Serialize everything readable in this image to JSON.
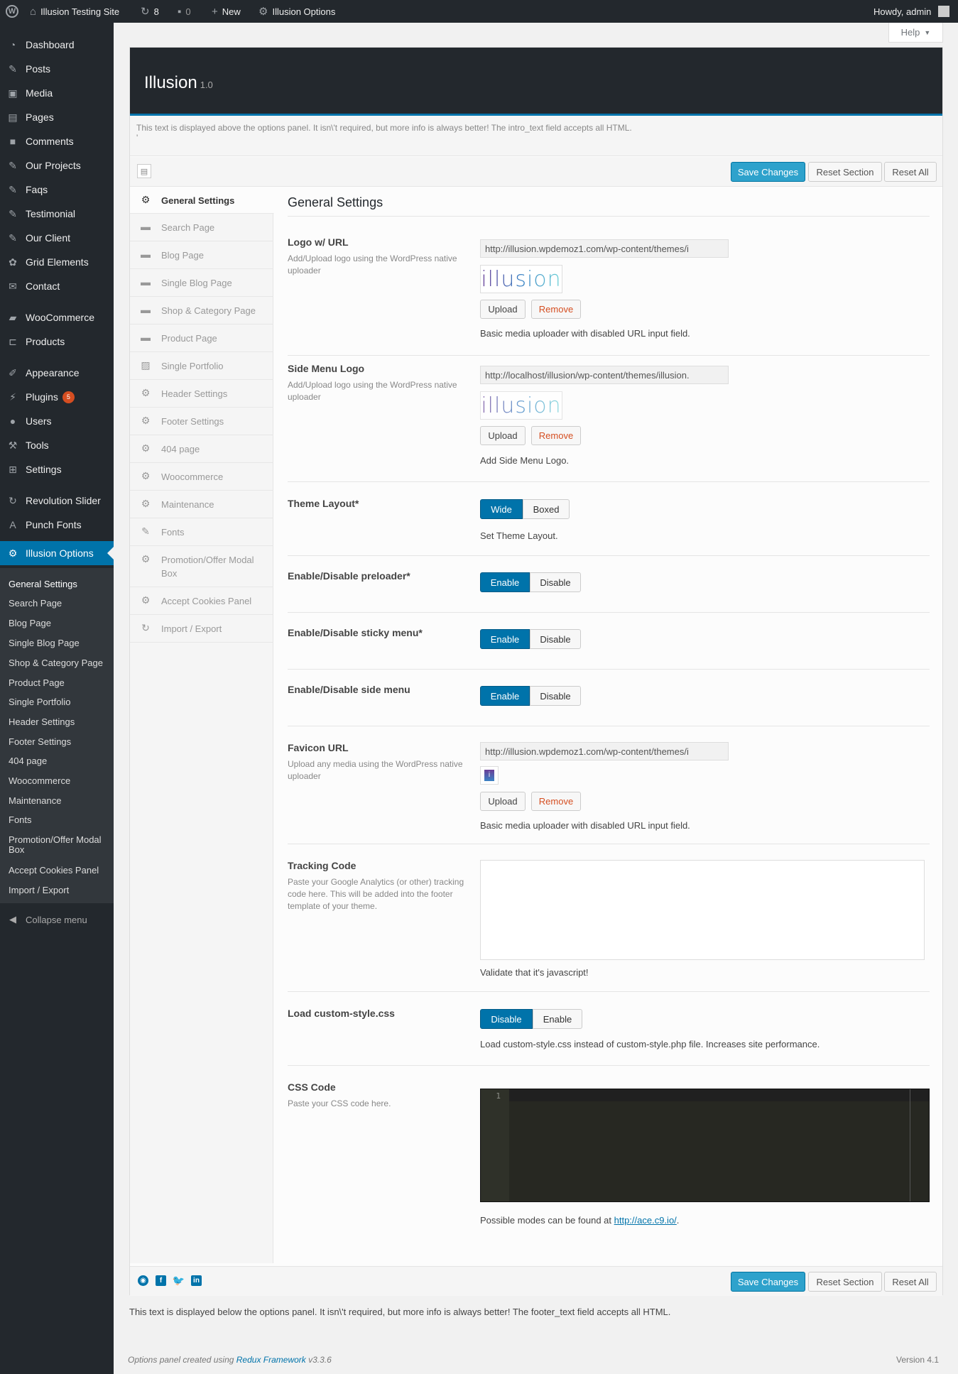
{
  "adminbar": {
    "site": "Illusion Testing Site",
    "updates": "8",
    "comments": "0",
    "new": "New",
    "options": "Illusion Options",
    "howdy": "Howdy, admin"
  },
  "menu": [
    {
      "label": "Dashboard",
      "icon": "dashboard-icon",
      "glyph": "◔"
    },
    {
      "label": "Posts",
      "icon": "pin-icon",
      "glyph": "✎"
    },
    {
      "label": "Media",
      "icon": "media-icon",
      "glyph": "▣"
    },
    {
      "label": "Pages",
      "icon": "pages-icon",
      "glyph": "▤"
    },
    {
      "label": "Comments",
      "icon": "comment-icon",
      "glyph": "■"
    },
    {
      "label": "Our Projects",
      "icon": "pin-icon",
      "glyph": "✎"
    },
    {
      "label": "Faqs",
      "icon": "pin-icon",
      "glyph": "✎"
    },
    {
      "label": "Testimonial",
      "icon": "pin-icon",
      "glyph": "✎"
    },
    {
      "label": "Our Client",
      "icon": "pin-icon",
      "glyph": "✎"
    },
    {
      "label": "Grid Elements",
      "icon": "grid-elements-icon",
      "glyph": "✿"
    },
    {
      "label": "Contact",
      "icon": "mail-icon",
      "glyph": "✉"
    },
    {
      "label": "WooCommerce",
      "icon": "woocommerce-icon",
      "glyph": "▰"
    },
    {
      "label": "Products",
      "icon": "cart-icon",
      "glyph": "⊏"
    },
    {
      "label": "Appearance",
      "icon": "brush-icon",
      "glyph": "✐"
    },
    {
      "label": "Plugins",
      "icon": "plugin-icon",
      "glyph": "⚡",
      "badge": "5"
    },
    {
      "label": "Users",
      "icon": "user-icon",
      "glyph": "●"
    },
    {
      "label": "Tools",
      "icon": "wrench-icon",
      "glyph": "⚒"
    },
    {
      "label": "Settings",
      "icon": "settings-icon",
      "glyph": "⊞"
    },
    {
      "label": "Revolution Slider",
      "icon": "refresh-icon",
      "glyph": "↻"
    },
    {
      "label": "Punch Fonts",
      "icon": "font-icon",
      "glyph": "A"
    },
    {
      "label": "Illusion Options",
      "icon": "gear-icon",
      "glyph": "⚙"
    }
  ],
  "submenu": [
    "General Settings",
    "Search Page",
    "Blog Page",
    "Single Blog Page",
    "Shop & Category Page",
    "Product Page",
    "Single Portfolio",
    "Header Settings",
    "Footer Settings",
    "404 page",
    "Woocommerce",
    "Maintenance",
    "Fonts",
    "Promotion/Offer Modal Box",
    "Accept Cookies Panel",
    "Import / Export"
  ],
  "collapse": "Collapse menu",
  "help": "Help",
  "panel": {
    "title": "Illusion",
    "version": "1.0",
    "intro": "This text is displayed above the options panel. It isn\\'t required, but more info is always better! The intro_text field accepts all HTML.",
    "intro2": "'",
    "save": "Save Changes",
    "reset_section": "Reset Section",
    "reset_all": "Reset All",
    "nav": [
      {
        "label": "General Settings",
        "icon": "gears-icon",
        "glyph": "⚙"
      },
      {
        "label": "Search Page",
        "icon": "briefcase-icon",
        "glyph": "▬"
      },
      {
        "label": "Blog Page",
        "icon": "briefcase-icon",
        "glyph": "▬"
      },
      {
        "label": "Single Blog Page",
        "icon": "briefcase-icon",
        "glyph": "▬"
      },
      {
        "label": "Shop & Category Page",
        "icon": "briefcase-icon",
        "glyph": "▬"
      },
      {
        "label": "Product Page",
        "icon": "briefcase-icon",
        "glyph": "▬"
      },
      {
        "label": "Single Portfolio",
        "icon": "picture-icon",
        "glyph": "▨"
      },
      {
        "label": "Header Settings",
        "icon": "gears-icon",
        "glyph": "⚙"
      },
      {
        "label": "Footer Settings",
        "icon": "gears-icon",
        "glyph": "⚙"
      },
      {
        "label": "404 page",
        "icon": "gears-icon",
        "glyph": "⚙"
      },
      {
        "label": "Woocommerce",
        "icon": "gears-icon",
        "glyph": "⚙"
      },
      {
        "label": "Maintenance",
        "icon": "gears-icon",
        "glyph": "⚙"
      },
      {
        "label": "Fonts",
        "icon": "edit-icon",
        "glyph": "✎"
      },
      {
        "label": "Promotion/Offer Modal Box",
        "icon": "gears-icon",
        "glyph": "⚙"
      },
      {
        "label": "Accept Cookies Panel",
        "icon": "gears-icon",
        "glyph": "⚙"
      },
      {
        "label": "Import / Export",
        "icon": "refresh-icon",
        "glyph": "↻"
      }
    ],
    "section_title": "General Settings",
    "logo": {
      "title": "Logo w/ URL",
      "sub": "Add/Upload logo using the WordPress native uploader",
      "url": "http://illusion.wpdemoz1.com/wp-content/themes/i",
      "image_text": "illusion",
      "upload": "Upload",
      "remove": "Remove",
      "desc": "Basic media uploader with disabled URL input field."
    },
    "sidelogo": {
      "title": "Side Menu Logo",
      "sub": "Add/Upload logo using the WordPress native uploader",
      "url": "http://localhost/illusion/wp-content/themes/illusion.",
      "image_text": "illusion",
      "upload": "Upload",
      "remove": "Remove",
      "desc": "Add Side Menu Logo."
    },
    "layout": {
      "title": "Theme Layout*",
      "options": [
        "Wide",
        "Boxed"
      ],
      "selected": "Wide",
      "desc": "Set Theme Layout."
    },
    "preloader": {
      "title": "Enable/Disable preloader*",
      "options": [
        "Enable",
        "Disable"
      ],
      "selected": "Enable"
    },
    "sticky": {
      "title": "Enable/Disable sticky menu*",
      "options": [
        "Enable",
        "Disable"
      ],
      "selected": "Enable"
    },
    "sidemenu": {
      "title": "Enable/Disable side menu",
      "options": [
        "Enable",
        "Disable"
      ],
      "selected": "Enable"
    },
    "favicon": {
      "title": "Favicon URL",
      "sub": "Upload any media using the WordPress native uploader",
      "url": "http://illusion.wpdemoz1.com/wp-content/themes/i",
      "upload": "Upload",
      "remove": "Remove",
      "desc": "Basic media uploader with disabled URL input field."
    },
    "tracking": {
      "title": "Tracking Code",
      "sub": "Paste your Google Analytics (or other) tracking code here. This will be added into the footer template of your theme.",
      "value": "",
      "desc": "Validate that it's javascript!"
    },
    "customcss": {
      "title": "Load custom-style.css",
      "options": [
        "Disable",
        "Enable"
      ],
      "selected": "Disable",
      "desc": "Load custom-style.css instead of custom-style.php file. Increases site performance."
    },
    "csscode": {
      "title": "CSS Code",
      "sub": "Paste your CSS code here.",
      "line": "1",
      "desc_pre": "Possible modes can be found at ",
      "link": "http://ace.c9.io/",
      "desc_post": "."
    }
  },
  "footer": {
    "below": "This text is displayed below the options panel. It isn\\'t required, but more info is always better! The footer_text field accepts all HTML.",
    "credits_pre": "Options panel created using ",
    "credits_link": "Redux Framework",
    "credits_ver": " v3.3.6",
    "version": "Version 4.1"
  },
  "colors": {
    "accent": "#0073aa",
    "button": "#2ea2cc",
    "adminbar": "#23282d",
    "remove": "#d54e21"
  }
}
